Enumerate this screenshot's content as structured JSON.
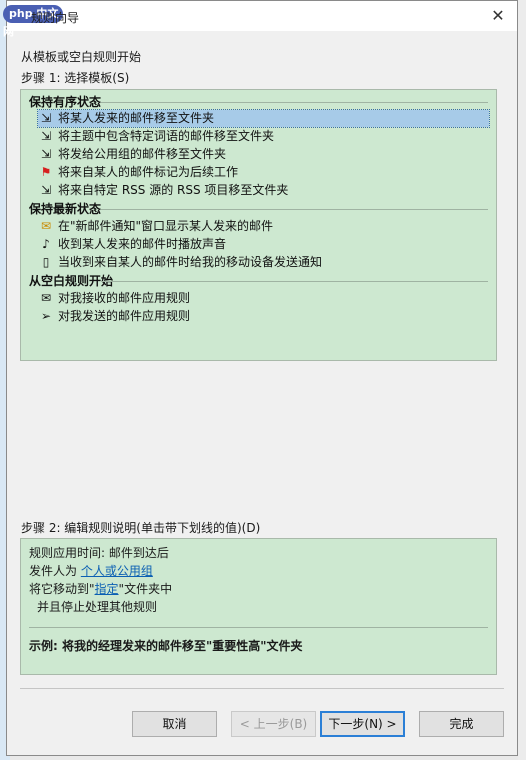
{
  "window": {
    "title": "规则向导",
    "watermark": "php 中文网"
  },
  "intro": "从模板或空白规则开始",
  "step1": {
    "label": "步骤 1: 选择模板(S)",
    "groups": [
      {
        "header": "保持有序状态",
        "items": [
          {
            "label": "将某人发来的邮件移至文件夹",
            "icon": "move-to-folder-icon",
            "selected": true
          },
          {
            "label": "将主题中包含特定词语的邮件移至文件夹",
            "icon": "move-to-folder-icon"
          },
          {
            "label": "将发给公用组的邮件移至文件夹",
            "icon": "move-to-folder-icon"
          },
          {
            "label": "将来自某人的邮件标记为后续工作",
            "icon": "red-flag-icon"
          },
          {
            "label": "将来自特定 RSS 源的 RSS 项目移至文件夹",
            "icon": "move-to-folder-icon"
          }
        ]
      },
      {
        "header": "保持最新状态",
        "items": [
          {
            "label": "在\"新邮件通知\"窗口显示某人发来的邮件",
            "icon": "new-mail-alert-icon"
          },
          {
            "label": "收到某人发来的邮件时播放声音",
            "icon": "speaker-icon"
          },
          {
            "label": "当收到来自某人的邮件时给我的移动设备发送通知",
            "icon": "mobile-device-icon"
          }
        ]
      },
      {
        "header": "从空白规则开始",
        "items": [
          {
            "label": "对我接收的邮件应用规则",
            "icon": "envelope-icon"
          },
          {
            "label": "对我发送的邮件应用规则",
            "icon": "send-icon"
          }
        ]
      }
    ]
  },
  "step2": {
    "label": "步骤 2: 编辑规则说明(单击带下划线的值)(D)",
    "line1": "规则应用时间: 邮件到达后",
    "line2_prefix": "发件人为 ",
    "line2_link": "个人或公用组",
    "line3_prefix": "将它移动到\"",
    "line3_link": "指定",
    "line3_suffix": "\"文件夹中",
    "line4": "并且停止处理其他规则",
    "example": "示例: 将我的经理发来的邮件移至\"重要性高\"文件夹"
  },
  "buttons": {
    "cancel": "取消",
    "back": "< 上一步(B)",
    "next": "下一步(N) >",
    "finish": "完成"
  }
}
